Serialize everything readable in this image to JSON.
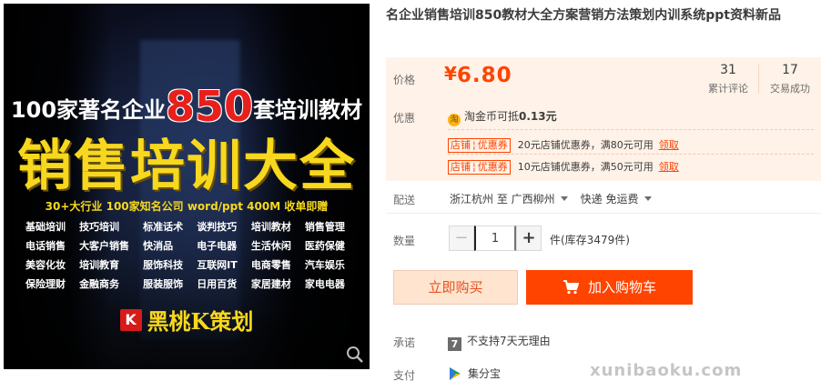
{
  "image": {
    "headline_pre": "100家著名企业",
    "headline_num": "850",
    "headline_post": "套培训教材",
    "main_title": "销售培训大全",
    "subline": "30+大行业 100家知名公司 word/ppt  400M  收单即赠",
    "categories": [
      "基础培训",
      "技巧培训",
      "标准话术",
      "谈判技巧",
      "培训教材",
      "销售管理",
      "电话销售",
      "大客户销售",
      "快消品",
      "电子电器",
      "生活休闲",
      "医药保健",
      "美容化妆",
      "培训教育",
      "服饰科技",
      "互联网IT",
      "电商零售",
      "汽车娱乐",
      "保险理财",
      "金融商务",
      "服装服饰",
      "日用百货",
      "家居建材",
      "家电电器"
    ],
    "brand_logo": "K",
    "brand_name": "黑桃K策划",
    "zoom_icon": "magnifier-icon"
  },
  "product": {
    "title": "名企业销售培训850教材大全方案营销方法策划内训系统ppt资料新品"
  },
  "price": {
    "label": "价格",
    "currency": "¥",
    "amount": "6.80",
    "color": "#ff4400"
  },
  "stats": {
    "reviews_count": "31",
    "reviews_label": "累计评论",
    "deals_count": "17",
    "deals_label": "交易成功"
  },
  "promo": {
    "label": "优惠",
    "coin_icon": "淘",
    "coin_text_pre": "淘金币可抵",
    "coin_amount": "0.13元",
    "coupons": [
      {
        "tag_left": "店铺",
        "tag_right": "优惠券",
        "text": "20元店铺优惠券，满80元可用",
        "link": "领取"
      },
      {
        "tag_left": "店铺",
        "tag_right": "优惠券",
        "text": "10元店铺优惠券，满50元可用",
        "link": "领取"
      }
    ]
  },
  "shipping": {
    "label": "配送",
    "from": "浙江杭州 至",
    "to": "广西柳州",
    "method": "快递 免运费"
  },
  "quantity": {
    "label": "数量",
    "minus": "−",
    "value": "1",
    "plus": "+",
    "stock": "件(库存3479件)"
  },
  "actions": {
    "buy_now": "立即购买",
    "add_cart": "加入购物车"
  },
  "promise": {
    "label": "承诺",
    "icon": "7",
    "text": "不支持7天无理由"
  },
  "payment": {
    "label": "支付",
    "method": "集分宝"
  },
  "watermark": "xunibaoku.com"
}
